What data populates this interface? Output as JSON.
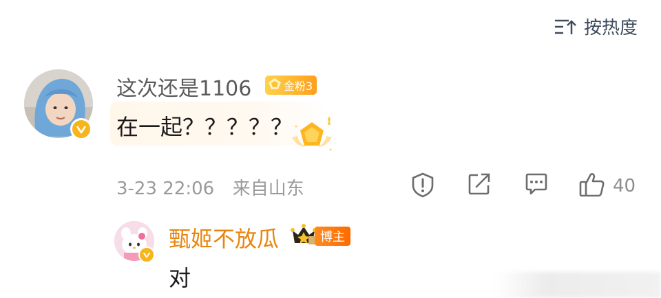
{
  "sort": {
    "label": "按热度",
    "icon": "sort-icon"
  },
  "comment": {
    "username": "这次还是1106",
    "fan_badge": "金粉3",
    "text": "在一起？？？？？",
    "date": "3-23 22:06",
    "location": "来自山东",
    "like_count": "40",
    "verified_icon": "verified-icon",
    "colors": {
      "fan_badge": "#ffb21f",
      "verified": "#f6b51a"
    }
  },
  "reply": {
    "username": "甄姬不放瓜",
    "role_badge": "博主",
    "text": "对",
    "colors": {
      "name": "#e8850e",
      "role_badge": "#ff7a10"
    }
  },
  "actions": {
    "report_icon": "report-shield-icon",
    "share_icon": "share-icon",
    "comment_icon": "comment-icon",
    "like_icon": "thumbs-up-icon"
  }
}
